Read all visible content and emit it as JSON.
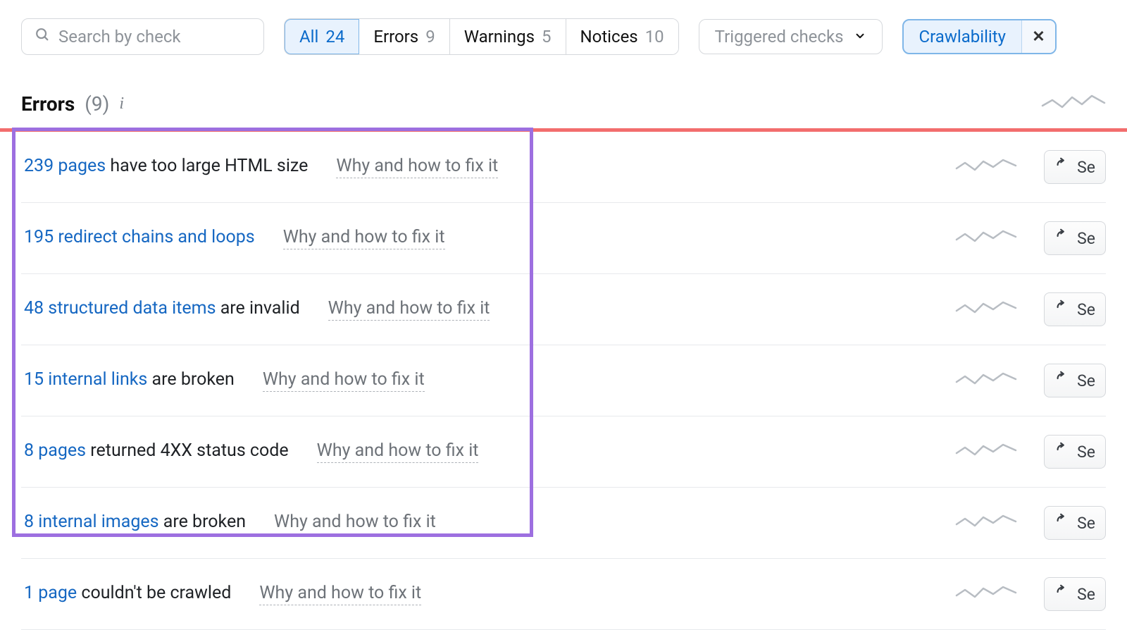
{
  "search": {
    "placeholder": "Search by check"
  },
  "tabs": [
    {
      "label": "All",
      "count": "24",
      "active": true
    },
    {
      "label": "Errors",
      "count": "9",
      "active": false
    },
    {
      "label": "Warnings",
      "count": "5",
      "active": false
    },
    {
      "label": "Notices",
      "count": "10",
      "active": false
    }
  ],
  "triggered": {
    "label": "Triggered checks"
  },
  "chip": {
    "label": "Crawlability",
    "close": "✕"
  },
  "section": {
    "title": "Errors",
    "count": "(9)"
  },
  "fix_label": "Why and how to fix it",
  "send_label": "Se",
  "issues": [
    {
      "link": "239 pages",
      "rest": " have too large HTML size"
    },
    {
      "link": "195 redirect chains and loops",
      "rest": ""
    },
    {
      "link": "48 structured data items",
      "rest": " are invalid"
    },
    {
      "link": "15 internal links",
      "rest": " are broken"
    },
    {
      "link": "8 pages",
      "rest": " returned 4XX status code"
    },
    {
      "link": "8 internal images",
      "rest": " are broken"
    },
    {
      "link": "1 page",
      "rest": " couldn't be crawled"
    }
  ]
}
